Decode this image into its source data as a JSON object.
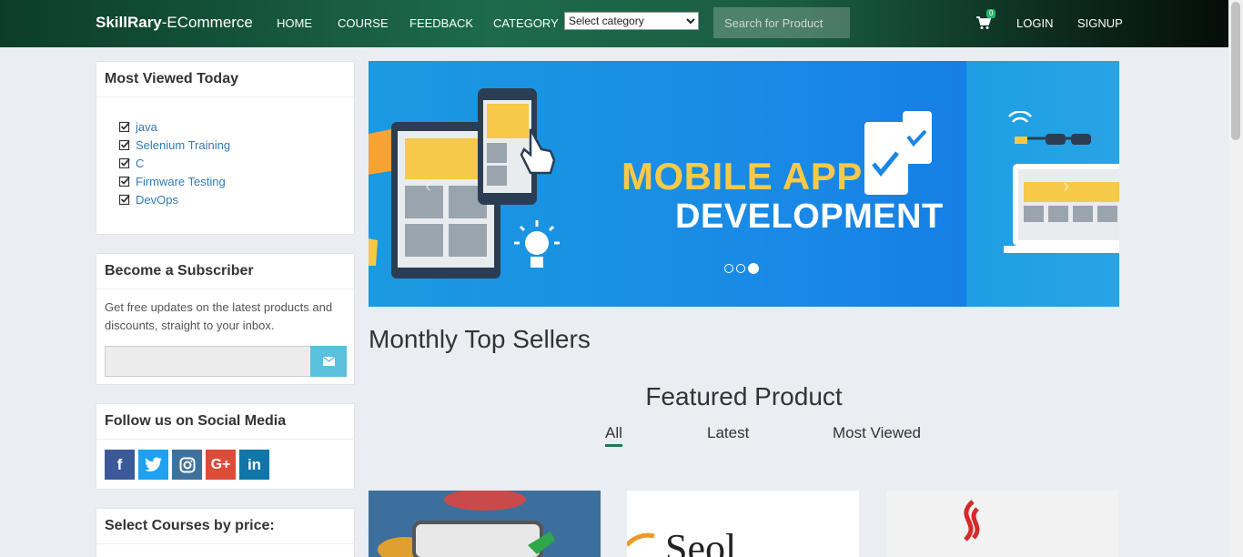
{
  "navbar": {
    "brand_bold": "SkillRary",
    "brand_rest": "-ECommerce",
    "links": [
      "HOME",
      "COURSE",
      "FEEDBACK",
      "CATEGORY"
    ],
    "category_select": "Select category",
    "search_placeholder": "Search for Product",
    "cart_count": "0",
    "login": "LOGIN",
    "signup": "SIGNUP"
  },
  "sidebar": {
    "most_viewed": {
      "title": "Most Viewed Today",
      "items": [
        "java",
        "Selenium Training",
        "C",
        "Firmware Testing",
        "DevOps"
      ]
    },
    "subscriber": {
      "title": "Become a Subscriber",
      "text": "Get free updates on the latest products and discounts, straight to your inbox."
    },
    "social": {
      "title": "Follow us on Social Media",
      "icons": [
        "facebook-icon",
        "twitter-icon",
        "instagram-icon",
        "google-plus-icon",
        "linkedin-icon"
      ]
    },
    "price": {
      "title": "Select Courses by price:"
    }
  },
  "carousel": {
    "line1": "MOBILE APP",
    "line2": "DEVELOPMENT",
    "slide_count": 3,
    "active_slide": 3
  },
  "main": {
    "top_sellers": "Monthly Top Sellers",
    "featured": "Featured Product",
    "tabs": [
      "All",
      "Latest",
      "Most Viewed"
    ],
    "active_tab": "All"
  },
  "colors": {
    "accent": "#1e7b4f",
    "link": "#337ab7",
    "subscribe_button": "#5bc0de",
    "banner_yellow": "#f7c948"
  }
}
